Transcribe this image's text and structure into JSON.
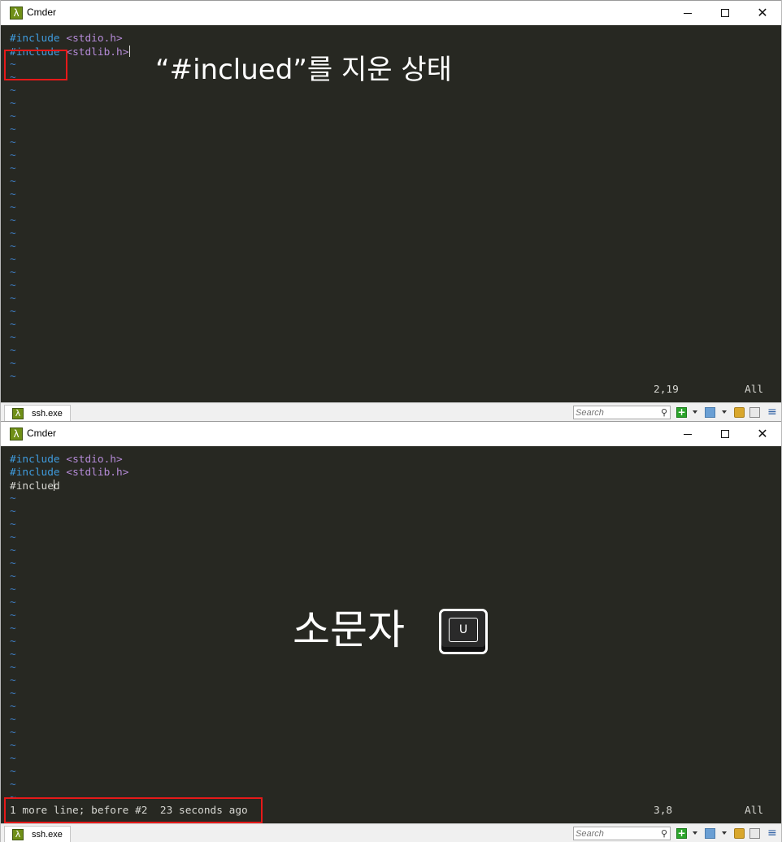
{
  "top_window": {
    "title": "Cmder",
    "app_icon": "λ",
    "lines": [
      {
        "keyword": "#include",
        "rest": " ",
        "header": "<stdio.h>"
      },
      {
        "keyword": "#include",
        "rest": " ",
        "header": "<stdlib.h>"
      }
    ],
    "tilde": "~",
    "status": {
      "position": "2,19",
      "scroll": "All"
    },
    "tab": {
      "label": "ssh.exe"
    },
    "search": {
      "placeholder": "Search"
    },
    "annotation": "“#inclued”를 지운 상태"
  },
  "bottom_window": {
    "title": "Cmder",
    "app_icon": "λ",
    "lines": [
      {
        "keyword": "#include",
        "rest": " ",
        "header": "<stdio.h>"
      },
      {
        "keyword": "#include",
        "rest": " ",
        "header": "<stdlib.h>"
      },
      {
        "plain_before_cursor": "#inclue",
        "plain_after_cursor": "d"
      }
    ],
    "tilde": "~",
    "status": {
      "message": "1 more line; before #2  23 seconds ago",
      "position": "3,8",
      "scroll": "All"
    },
    "tab": {
      "label": "ssh.exe"
    },
    "search": {
      "placeholder": "Search"
    },
    "annotation": {
      "text": "소문자",
      "key": "U"
    }
  },
  "icons": {
    "lambda": "λ",
    "search": "⚲",
    "plus": "+",
    "menu": "≡",
    "close": "✕"
  },
  "colors": {
    "editor_bg": "#272822",
    "keyword": "#3f9bdd",
    "header": "#b58bd8",
    "tilde": "#3f7fc6",
    "highlight": "#e61919"
  }
}
